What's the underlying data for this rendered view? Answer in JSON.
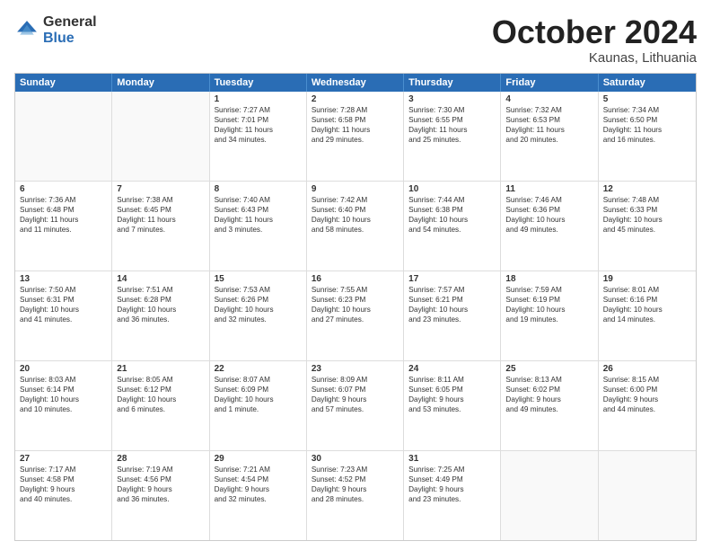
{
  "logo": {
    "general": "General",
    "blue": "Blue"
  },
  "title": "October 2024",
  "location": "Kaunas, Lithuania",
  "days": [
    "Sunday",
    "Monday",
    "Tuesday",
    "Wednesday",
    "Thursday",
    "Friday",
    "Saturday"
  ],
  "rows": [
    [
      {
        "day": "",
        "empty": true
      },
      {
        "day": "",
        "empty": true
      },
      {
        "day": "1",
        "line1": "Sunrise: 7:27 AM",
        "line2": "Sunset: 7:01 PM",
        "line3": "Daylight: 11 hours",
        "line4": "and 34 minutes."
      },
      {
        "day": "2",
        "line1": "Sunrise: 7:28 AM",
        "line2": "Sunset: 6:58 PM",
        "line3": "Daylight: 11 hours",
        "line4": "and 29 minutes."
      },
      {
        "day": "3",
        "line1": "Sunrise: 7:30 AM",
        "line2": "Sunset: 6:55 PM",
        "line3": "Daylight: 11 hours",
        "line4": "and 25 minutes."
      },
      {
        "day": "4",
        "line1": "Sunrise: 7:32 AM",
        "line2": "Sunset: 6:53 PM",
        "line3": "Daylight: 11 hours",
        "line4": "and 20 minutes."
      },
      {
        "day": "5",
        "line1": "Sunrise: 7:34 AM",
        "line2": "Sunset: 6:50 PM",
        "line3": "Daylight: 11 hours",
        "line4": "and 16 minutes."
      }
    ],
    [
      {
        "day": "6",
        "line1": "Sunrise: 7:36 AM",
        "line2": "Sunset: 6:48 PM",
        "line3": "Daylight: 11 hours",
        "line4": "and 11 minutes."
      },
      {
        "day": "7",
        "line1": "Sunrise: 7:38 AM",
        "line2": "Sunset: 6:45 PM",
        "line3": "Daylight: 11 hours",
        "line4": "and 7 minutes."
      },
      {
        "day": "8",
        "line1": "Sunrise: 7:40 AM",
        "line2": "Sunset: 6:43 PM",
        "line3": "Daylight: 11 hours",
        "line4": "and 3 minutes."
      },
      {
        "day": "9",
        "line1": "Sunrise: 7:42 AM",
        "line2": "Sunset: 6:40 PM",
        "line3": "Daylight: 10 hours",
        "line4": "and 58 minutes."
      },
      {
        "day": "10",
        "line1": "Sunrise: 7:44 AM",
        "line2": "Sunset: 6:38 PM",
        "line3": "Daylight: 10 hours",
        "line4": "and 54 minutes."
      },
      {
        "day": "11",
        "line1": "Sunrise: 7:46 AM",
        "line2": "Sunset: 6:36 PM",
        "line3": "Daylight: 10 hours",
        "line4": "and 49 minutes."
      },
      {
        "day": "12",
        "line1": "Sunrise: 7:48 AM",
        "line2": "Sunset: 6:33 PM",
        "line3": "Daylight: 10 hours",
        "line4": "and 45 minutes."
      }
    ],
    [
      {
        "day": "13",
        "line1": "Sunrise: 7:50 AM",
        "line2": "Sunset: 6:31 PM",
        "line3": "Daylight: 10 hours",
        "line4": "and 41 minutes."
      },
      {
        "day": "14",
        "line1": "Sunrise: 7:51 AM",
        "line2": "Sunset: 6:28 PM",
        "line3": "Daylight: 10 hours",
        "line4": "and 36 minutes."
      },
      {
        "day": "15",
        "line1": "Sunrise: 7:53 AM",
        "line2": "Sunset: 6:26 PM",
        "line3": "Daylight: 10 hours",
        "line4": "and 32 minutes."
      },
      {
        "day": "16",
        "line1": "Sunrise: 7:55 AM",
        "line2": "Sunset: 6:23 PM",
        "line3": "Daylight: 10 hours",
        "line4": "and 27 minutes."
      },
      {
        "day": "17",
        "line1": "Sunrise: 7:57 AM",
        "line2": "Sunset: 6:21 PM",
        "line3": "Daylight: 10 hours",
        "line4": "and 23 minutes."
      },
      {
        "day": "18",
        "line1": "Sunrise: 7:59 AM",
        "line2": "Sunset: 6:19 PM",
        "line3": "Daylight: 10 hours",
        "line4": "and 19 minutes."
      },
      {
        "day": "19",
        "line1": "Sunrise: 8:01 AM",
        "line2": "Sunset: 6:16 PM",
        "line3": "Daylight: 10 hours",
        "line4": "and 14 minutes."
      }
    ],
    [
      {
        "day": "20",
        "line1": "Sunrise: 8:03 AM",
        "line2": "Sunset: 6:14 PM",
        "line3": "Daylight: 10 hours",
        "line4": "and 10 minutes."
      },
      {
        "day": "21",
        "line1": "Sunrise: 8:05 AM",
        "line2": "Sunset: 6:12 PM",
        "line3": "Daylight: 10 hours",
        "line4": "and 6 minutes."
      },
      {
        "day": "22",
        "line1": "Sunrise: 8:07 AM",
        "line2": "Sunset: 6:09 PM",
        "line3": "Daylight: 10 hours",
        "line4": "and 1 minute."
      },
      {
        "day": "23",
        "line1": "Sunrise: 8:09 AM",
        "line2": "Sunset: 6:07 PM",
        "line3": "Daylight: 9 hours",
        "line4": "and 57 minutes."
      },
      {
        "day": "24",
        "line1": "Sunrise: 8:11 AM",
        "line2": "Sunset: 6:05 PM",
        "line3": "Daylight: 9 hours",
        "line4": "and 53 minutes."
      },
      {
        "day": "25",
        "line1": "Sunrise: 8:13 AM",
        "line2": "Sunset: 6:02 PM",
        "line3": "Daylight: 9 hours",
        "line4": "and 49 minutes."
      },
      {
        "day": "26",
        "line1": "Sunrise: 8:15 AM",
        "line2": "Sunset: 6:00 PM",
        "line3": "Daylight: 9 hours",
        "line4": "and 44 minutes."
      }
    ],
    [
      {
        "day": "27",
        "line1": "Sunrise: 7:17 AM",
        "line2": "Sunset: 4:58 PM",
        "line3": "Daylight: 9 hours",
        "line4": "and 40 minutes."
      },
      {
        "day": "28",
        "line1": "Sunrise: 7:19 AM",
        "line2": "Sunset: 4:56 PM",
        "line3": "Daylight: 9 hours",
        "line4": "and 36 minutes."
      },
      {
        "day": "29",
        "line1": "Sunrise: 7:21 AM",
        "line2": "Sunset: 4:54 PM",
        "line3": "Daylight: 9 hours",
        "line4": "and 32 minutes."
      },
      {
        "day": "30",
        "line1": "Sunrise: 7:23 AM",
        "line2": "Sunset: 4:52 PM",
        "line3": "Daylight: 9 hours",
        "line4": "and 28 minutes."
      },
      {
        "day": "31",
        "line1": "Sunrise: 7:25 AM",
        "line2": "Sunset: 4:49 PM",
        "line3": "Daylight: 9 hours",
        "line4": "and 23 minutes."
      },
      {
        "day": "",
        "empty": true
      },
      {
        "day": "",
        "empty": true
      }
    ]
  ]
}
